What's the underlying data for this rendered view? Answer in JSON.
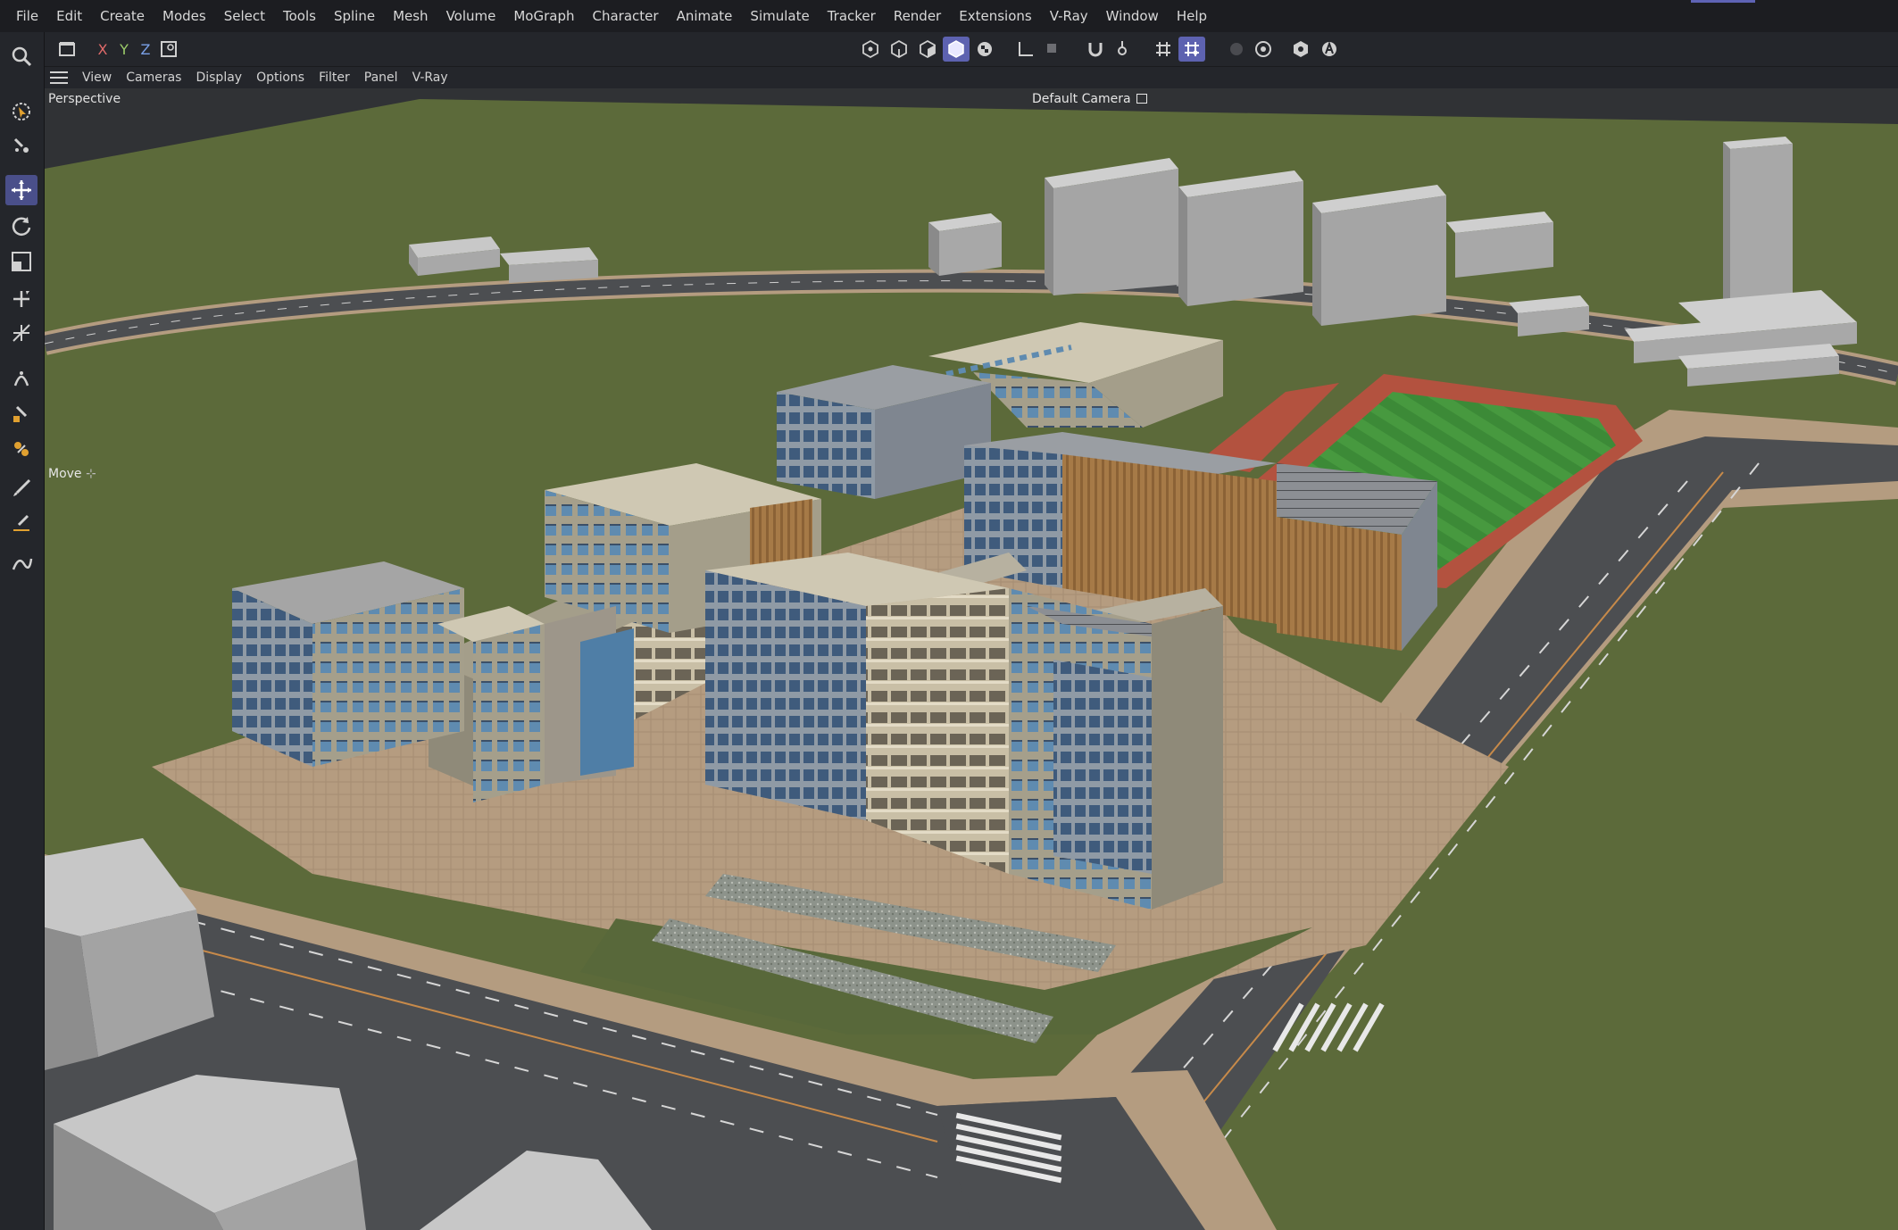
{
  "menubar": {
    "items": [
      "File",
      "Edit",
      "Create",
      "Modes",
      "Select",
      "Tools",
      "Spline",
      "Mesh",
      "Volume",
      "MoGraph",
      "Character",
      "Animate",
      "Simulate",
      "Tracker",
      "Render",
      "Extensions",
      "V-Ray",
      "Window",
      "Help"
    ]
  },
  "toolbar": {
    "axis_x": "X",
    "axis_y": "Y",
    "axis_z": "Z"
  },
  "viewport_menu": {
    "items": [
      "View",
      "Cameras",
      "Display",
      "Options",
      "Filter",
      "Panel",
      "V-Ray"
    ]
  },
  "viewport": {
    "projection": "Perspective",
    "camera": "Default Camera",
    "active_tool": "Move"
  },
  "left_tools": [
    "magnifier-icon",
    "live-select-icon",
    "tweak-icon",
    "move-icon",
    "rotate-icon",
    "scale-icon",
    "transform-icon",
    "snap-scale-icon",
    "magnet-icon",
    "paint-icon",
    "weight-icon",
    "brush-icon",
    "knife-icon",
    "spline-pen-icon"
  ],
  "colors": {
    "accent": "#5d62b0",
    "grass": "#5d6a3b",
    "road": "#4d4f52",
    "paving": "#b79e82",
    "track": "#b3523f",
    "field": "#3f8a3a",
    "building_facade": "#a49e8a",
    "glass": "#5f8bb0"
  }
}
